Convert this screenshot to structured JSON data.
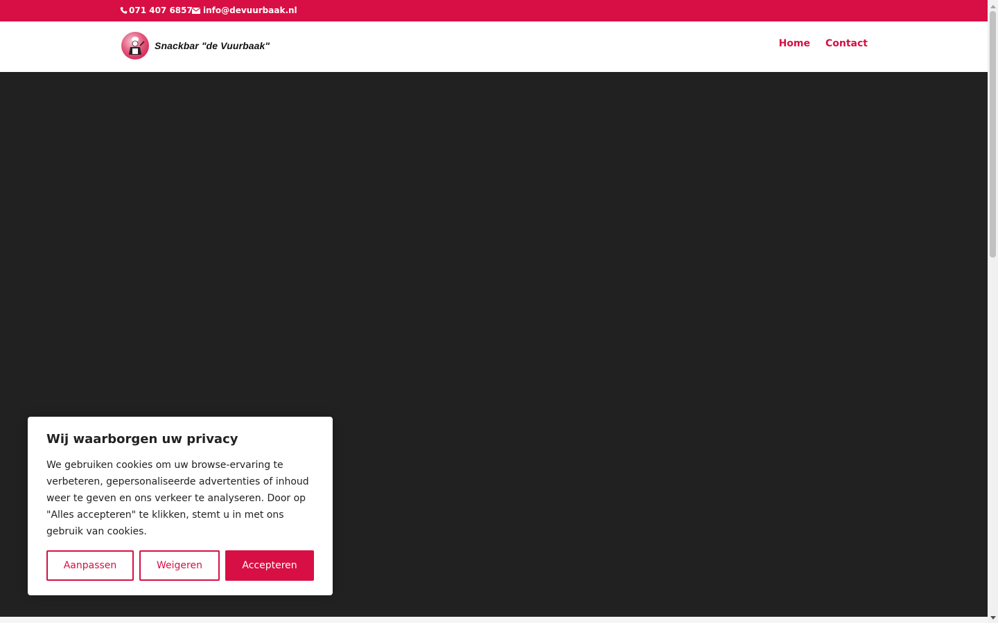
{
  "colors": {
    "brand_red": "#d80f44",
    "hero_bg": "#212121",
    "white": "#ffffff"
  },
  "topbar": {
    "phone": "071 407 6857",
    "email": "info@devuurbaak.nl",
    "phone_icon": "phone-icon",
    "email_icon": "envelope-icon"
  },
  "header": {
    "logo_text": "Snackbar \"de Vuurbaak\"",
    "nav": [
      {
        "label": "Home"
      },
      {
        "label": "Contact"
      }
    ]
  },
  "cookie": {
    "title": "Wij waarborgen uw privacy",
    "text": "We gebruiken cookies om uw browse-ervaring te verbeteren, gepersonaliseerde advertenties of inhoud weer te geven en ons verkeer te analyseren. Door op \"Alles accepteren\" te klikken, stemt u in met ons gebruik van cookies.",
    "buttons": {
      "customize": "Aanpassen",
      "reject": "Weigeren",
      "accept": "Accepteren"
    }
  }
}
